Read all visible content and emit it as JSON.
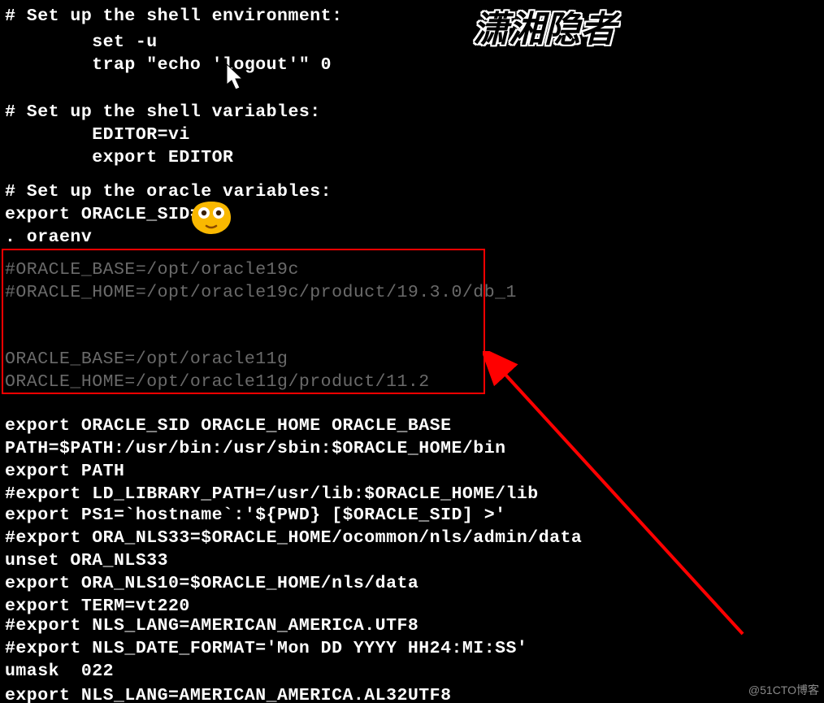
{
  "watermark_top": "潇湘隐者",
  "watermark_bottom": "@51CTO博客",
  "lines": {
    "l0": "# Set up the shell environment:",
    "l1": "        set -u",
    "l2": "        trap \"echo 'logout'\" 0",
    "l3": "# Set up the shell variables:",
    "l4": "        EDITOR=vi",
    "l5": "        export EDITOR",
    "l6": "# Set up the oracle variables:",
    "l7": "export ORACLE_SID=",
    "l8": ". oraenv",
    "l9": "#ORACLE_BASE=/opt/oracle19c",
    "l10": "#ORACLE_HOME=/opt/oracle19c/product/19.3.0/db_1",
    "l11": "ORACLE_BASE=/opt/oracle11g",
    "l12": "ORACLE_HOME=/opt/oracle11g/product/11.2",
    "l13": "export ORACLE_SID ORACLE_HOME ORACLE_BASE",
    "l14": "PATH=$PATH:/usr/bin:/usr/sbin:$ORACLE_HOME/bin",
    "l15": "export PATH",
    "l16": "#export LD_LIBRARY_PATH=/usr/lib:$ORACLE_HOME/lib",
    "l17": "export PS1=`hostname`:'${PWD} [$ORACLE_SID] >'",
    "l18": "#export ORA_NLS33=$ORACLE_HOME/ocommon/nls/admin/data",
    "l19": "unset ORA_NLS33",
    "l20": "export ORA_NLS10=$ORACLE_HOME/nls/data",
    "l21": "export TERM=vt220",
    "l22": "#export NLS_LANG=AMERICAN_AMERICA.UTF8",
    "l23": "#export NLS_DATE_FORMAT='Mon DD YYYY HH24:MI:SS'",
    "l24": "umask  022",
    "l25": "export NLS_LANG=AMERICAN_AMERICA.AL32UTF8"
  }
}
